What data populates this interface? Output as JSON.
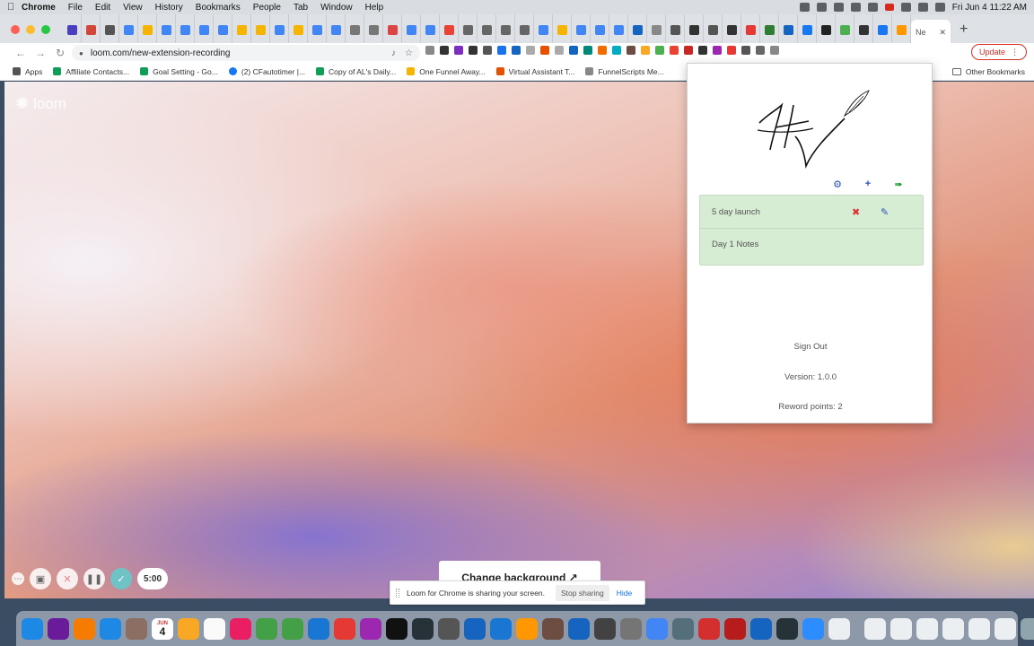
{
  "menubar": {
    "app": "Chrome",
    "items": [
      "File",
      "Edit",
      "View",
      "History",
      "Bookmarks",
      "People",
      "Tab",
      "Window",
      "Help"
    ],
    "clock": "Fri Jun 4  11:22 AM"
  },
  "tabs": {
    "active_tab_title": "Ne",
    "favicon_colors": [
      "#4a3fbf",
      "#d44638",
      "#555",
      "#4285f4",
      "#f4b400",
      "#4285f4",
      "#4285f4",
      "#4285f4",
      "#4285f4",
      "#f4b400",
      "#f4b400",
      "#4285f4",
      "#f4b400",
      "#4285f4",
      "#4285f4",
      "#777",
      "#777",
      "#d44",
      "#4285f4",
      "#4285f4",
      "#ea4335",
      "#666",
      "#666",
      "#666",
      "#666",
      "#4285f4",
      "#f4b400",
      "#4285f4",
      "#4285f4",
      "#4285f4",
      "#1565c0",
      "#888",
      "#555",
      "#333",
      "#555",
      "#333",
      "#e53935",
      "#2e7d32",
      "#1565c0",
      "#1877f2",
      "#222",
      "#4caf50",
      "#333",
      "#1877f2",
      "#ff9800"
    ]
  },
  "toolbar": {
    "url": "loom.com/new-extension-recording",
    "update_label": "Update",
    "ext_colors": [
      "#888",
      "#333",
      "#7b2fbf",
      "#333",
      "#555",
      "#1a73e8",
      "#1565c0",
      "#aaa",
      "#e65100",
      "#aaa",
      "#1565c0",
      "#00897b",
      "#ef6c00",
      "#00acc1",
      "#6d4c41",
      "#f9a825",
      "#4caf50",
      "#ea4335",
      "#c62828",
      "#333",
      "#9c27b0",
      "#e53935",
      "#555",
      "#666",
      "#888"
    ]
  },
  "bookmarks": {
    "items": [
      {
        "label": "Apps",
        "color": "#555"
      },
      {
        "label": "Affiliate Contacts...",
        "color": "#0f9d58"
      },
      {
        "label": "Goal Setting - Go...",
        "color": "#0f9d58"
      },
      {
        "label": "(2) CFautotimer |...",
        "color": "#1877f2"
      },
      {
        "label": "Copy of AL's Daily...",
        "color": "#0f9d58"
      },
      {
        "label": "One Funnel Away...",
        "color": "#f4b400"
      },
      {
        "label": "Virtual Assistant T...",
        "color": "#e65100"
      },
      {
        "label": "FunnelScripts Me...",
        "color": "#888"
      }
    ],
    "other": "Other Bookmarks"
  },
  "page": {
    "logo": "loom",
    "timer": "5:00",
    "change_background": "Change background",
    "share_message": "Loom for Chrome is sharing your screen.",
    "stop_sharing": "Stop sharing",
    "hide": "Hide"
  },
  "popup": {
    "signature_initials": "HW",
    "notes": [
      {
        "title": "5 day launch"
      },
      {
        "title": "Day 1 Notes"
      }
    ],
    "sign_out": "Sign Out",
    "version": "Version: 1.0.0",
    "reward_points": "Reword points: 2"
  },
  "dock": {
    "calendar_month": "JUN",
    "calendar_day": "4",
    "app_colors": [
      "#1e88e5",
      "#6a1b9a",
      "#f57c00",
      "#1e88e5",
      "#8d6e63",
      "#fff",
      "#f9a825",
      "#fafafa",
      "#e91e63",
      "#43a047",
      "#43a047",
      "#1976d2",
      "#e53935",
      "#9c27b0",
      "#111",
      "#263238",
      "#555",
      "#1565c0",
      "#1976d2",
      "#ff9800",
      "#6d4c41",
      "#1565c0",
      "#424242",
      "#757575",
      "#4285f4",
      "#546e7a",
      "#d32f2f",
      "#b71c1c",
      "#1565c0",
      "#263238",
      "#2d8cff",
      "#eceff1",
      "#eceff1",
      "#eceff1",
      "#eceff1",
      "#eceff1",
      "#eceff1",
      "#eceff1",
      "#90a4ae"
    ]
  }
}
